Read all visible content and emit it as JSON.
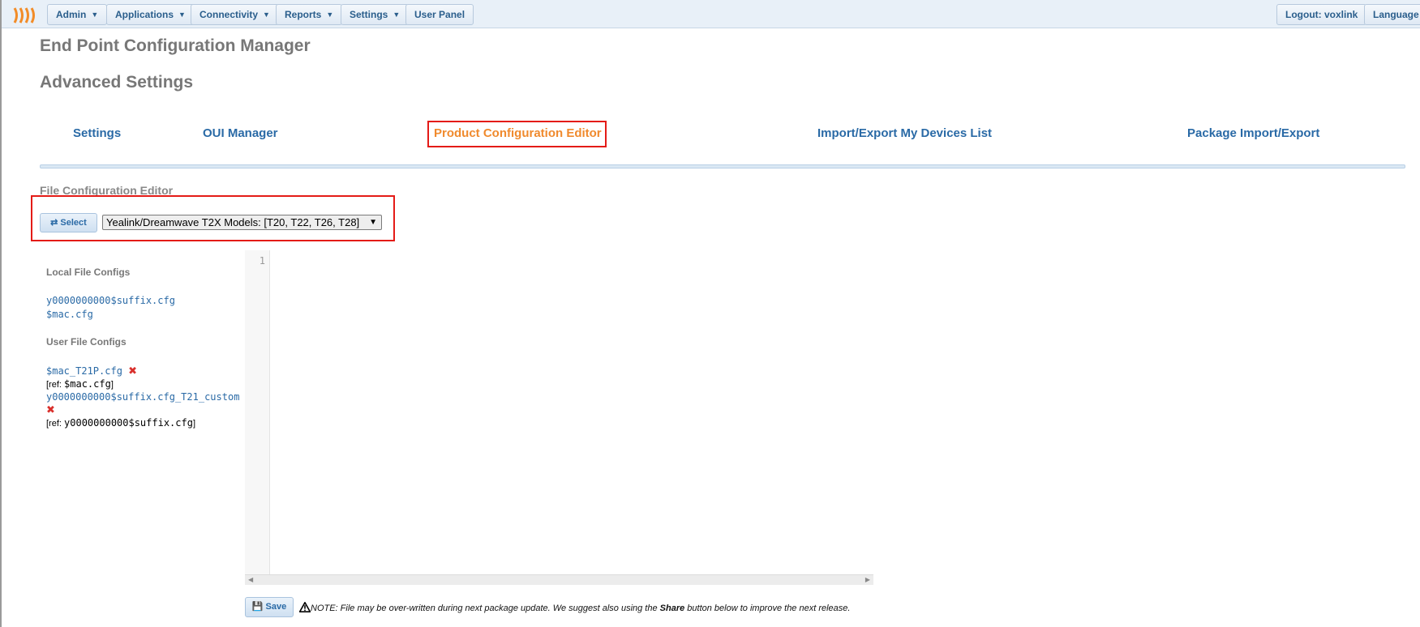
{
  "nav": {
    "admin": "Admin",
    "applications": "Applications",
    "connectivity": "Connectivity",
    "reports": "Reports",
    "settings": "Settings",
    "user_panel": "User Panel",
    "logout": "Logout: voxlink",
    "language": "Language"
  },
  "page": {
    "title": "End Point Configuration Manager",
    "subtitle": "Advanced Settings"
  },
  "tabs": {
    "settings": "Settings",
    "oui_manager": "OUI Manager",
    "product_config_editor": "Product Configuration Editor",
    "import_export_devices": "Import/Export My Devices List",
    "package_import_export": "Package Import/Export",
    "active": "Product Configuration Editor"
  },
  "editor_section": {
    "title": "File Configuration Editor",
    "select_label": "Select",
    "product_value": "Yealink/Dreamwave T2X Models: [T20, T22, T26, T28]"
  },
  "sidebar": {
    "local_heading": "Local File Configs",
    "local_files": [
      "y0000000000$suffix.cfg",
      "$mac.cfg"
    ],
    "user_heading": "User File Configs",
    "user_files": [
      {
        "name": "$mac_T21P.cfg",
        "ref_prefix": "[ref: ",
        "ref": "$mac.cfg",
        "ref_suffix": "]"
      },
      {
        "name": "y0000000000$suffix.cfg_T21_custom",
        "ref_prefix": "[ref: ",
        "ref": "y0000000000$suffix.cfg",
        "ref_suffix": "]"
      }
    ]
  },
  "code_editor": {
    "line_number": "1"
  },
  "footer": {
    "save_label": "Save",
    "note_prefix": "NOTE: File may be over-written during next package update. We suggest also using the ",
    "note_bold": "Share",
    "note_suffix": " button below to improve the next release."
  },
  "colors": {
    "link": "#2a6aa6",
    "active_tab": "#f08a2d",
    "highlight": "#e41b17",
    "delete": "#d9302c"
  },
  "icons": {
    "logo": "logo-icon",
    "caret": "caret-down-icon",
    "refresh": "refresh-icon",
    "delete": "delete-x-icon",
    "save": "floppy-disk-icon",
    "warning": "warning-triangle-icon"
  }
}
